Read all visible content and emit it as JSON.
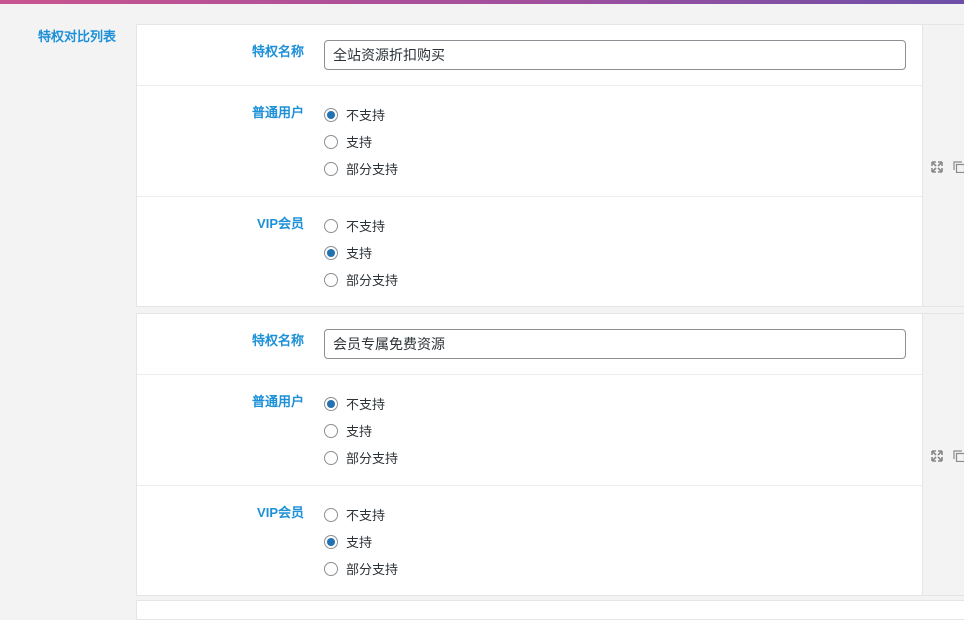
{
  "section": {
    "title": "特权对比列表"
  },
  "items": [
    {
      "name_label": "特权名称",
      "name_value": "全站资源折扣购买",
      "normal_user": {
        "label": "普通用户",
        "options": [
          {
            "text": "不支持",
            "checked": true
          },
          {
            "text": "支持",
            "checked": false
          },
          {
            "text": "部分支持",
            "checked": false
          }
        ]
      },
      "vip_user": {
        "label": "VIP会员",
        "options": [
          {
            "text": "不支持",
            "checked": false
          },
          {
            "text": "支持",
            "checked": true
          },
          {
            "text": "部分支持",
            "checked": false
          }
        ]
      }
    },
    {
      "name_label": "特权名称",
      "name_value": "会员专属免费资源",
      "normal_user": {
        "label": "普通用户",
        "options": [
          {
            "text": "不支持",
            "checked": true
          },
          {
            "text": "支持",
            "checked": false
          },
          {
            "text": "部分支持",
            "checked": false
          }
        ]
      },
      "vip_user": {
        "label": "VIP会员",
        "options": [
          {
            "text": "不支持",
            "checked": false
          },
          {
            "text": "支持",
            "checked": true
          },
          {
            "text": "部分支持",
            "checked": false
          }
        ]
      }
    }
  ],
  "icons": {
    "expand": "expand-icon",
    "copy": "copy-icon"
  },
  "colors": {
    "accent": "#1e90d8",
    "radio": "#2271b1"
  }
}
